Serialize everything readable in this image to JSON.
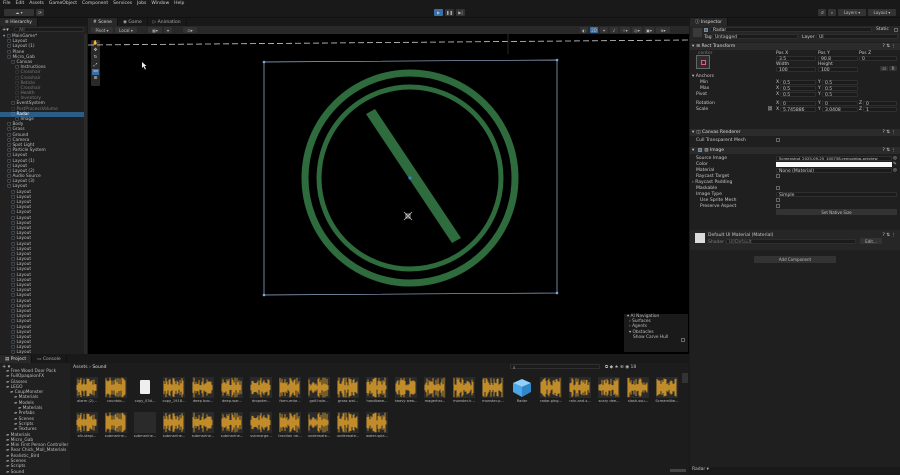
{
  "menu": [
    "File",
    "Edit",
    "Assets",
    "GameObject",
    "Component",
    "Services",
    "Jobs",
    "Window",
    "Help"
  ],
  "toolbar": {
    "account_label": "",
    "layers_label": "Layers",
    "layout_label": "Layout"
  },
  "hierarchy": {
    "tab_label": "Hierarchy",
    "search_placeholder": "All",
    "rows": [
      {
        "label": "MainGame*",
        "indent": 0,
        "style": "normal"
      },
      {
        "label": "Layout",
        "indent": 1,
        "style": "normal"
      },
      {
        "label": "Layout (1)",
        "indent": 1,
        "style": "normal"
      },
      {
        "label": "Plane",
        "indent": 1,
        "style": "normal"
      },
      {
        "label": "Micro_Gab",
        "indent": 1,
        "style": "normal"
      },
      {
        "label": "Canvas",
        "indent": 2,
        "style": "normal"
      },
      {
        "label": "Instructions",
        "indent": 3,
        "style": "normal"
      },
      {
        "label": "Crosshair",
        "indent": 3,
        "style": "dim"
      },
      {
        "label": "Crosshair",
        "indent": 3,
        "style": "dim"
      },
      {
        "label": "Reticle",
        "indent": 3,
        "style": "dim"
      },
      {
        "label": "Crosshair",
        "indent": 3,
        "style": "dim"
      },
      {
        "label": "Health",
        "indent": 3,
        "style": "dim"
      },
      {
        "label": "Inventory",
        "indent": 3,
        "style": "dim"
      },
      {
        "label": "EventSystem",
        "indent": 2,
        "style": "normal"
      },
      {
        "label": "PostProcessVolume",
        "indent": 2,
        "style": "dim"
      },
      {
        "label": "Radar",
        "indent": 2,
        "style": "selected"
      },
      {
        "label": "Image",
        "indent": 3,
        "style": "normal"
      },
      {
        "label": "Body",
        "indent": 1,
        "style": "normal"
      },
      {
        "label": "Grass",
        "indent": 1,
        "style": "normal"
      },
      {
        "label": "Ground",
        "indent": 1,
        "style": "normal"
      },
      {
        "label": "Camera",
        "indent": 1,
        "style": "normal"
      },
      {
        "label": "Spot Light",
        "indent": 1,
        "style": "normal"
      },
      {
        "label": "Particle System",
        "indent": 1,
        "style": "normal"
      },
      {
        "label": "Layout",
        "indent": 1,
        "style": "normal"
      },
      {
        "label": "Layout (1)",
        "indent": 1,
        "style": "normal"
      },
      {
        "label": "Layout",
        "indent": 1,
        "style": "normal"
      },
      {
        "label": "Layout (2)",
        "indent": 1,
        "style": "normal"
      },
      {
        "label": "Audio Source",
        "indent": 1,
        "style": "normal"
      },
      {
        "label": "Layout (3)",
        "indent": 1,
        "style": "normal"
      },
      {
        "label": "Layout",
        "indent": 1,
        "style": "normal"
      },
      {
        "label": "Layout",
        "indent": 2,
        "style": "normal"
      },
      {
        "label": "Layout",
        "indent": 2,
        "style": "normal"
      },
      {
        "label": "Layout",
        "indent": 2,
        "style": "normal"
      },
      {
        "label": "Layout",
        "indent": 2,
        "style": "normal"
      },
      {
        "label": "Layout",
        "indent": 2,
        "style": "normal"
      },
      {
        "label": "Layout",
        "indent": 2,
        "style": "normal"
      },
      {
        "label": "Layout",
        "indent": 2,
        "style": "normal"
      },
      {
        "label": "Layout",
        "indent": 2,
        "style": "normal"
      },
      {
        "label": "Layout",
        "indent": 2,
        "style": "normal"
      },
      {
        "label": "Layout",
        "indent": 2,
        "style": "normal"
      },
      {
        "label": "Layout",
        "indent": 2,
        "style": "normal"
      },
      {
        "label": "Layout",
        "indent": 2,
        "style": "normal"
      },
      {
        "label": "Layout",
        "indent": 2,
        "style": "normal"
      },
      {
        "label": "Layout",
        "indent": 2,
        "style": "normal"
      },
      {
        "label": "Layout",
        "indent": 2,
        "style": "normal"
      },
      {
        "label": "Layout",
        "indent": 2,
        "style": "normal"
      },
      {
        "label": "Layout",
        "indent": 2,
        "style": "normal"
      },
      {
        "label": "Layout",
        "indent": 2,
        "style": "normal"
      },
      {
        "label": "Layout",
        "indent": 2,
        "style": "normal"
      },
      {
        "label": "Layout",
        "indent": 2,
        "style": "normal"
      },
      {
        "label": "Layout",
        "indent": 2,
        "style": "normal"
      },
      {
        "label": "Layout",
        "indent": 2,
        "style": "normal"
      },
      {
        "label": "Layout",
        "indent": 2,
        "style": "normal"
      },
      {
        "label": "Layout",
        "indent": 2,
        "style": "normal"
      },
      {
        "label": "Layout",
        "indent": 2,
        "style": "normal"
      },
      {
        "label": "Layout",
        "indent": 2,
        "style": "normal"
      },
      {
        "label": "Layout",
        "indent": 2,
        "style": "normal"
      },
      {
        "label": "Layout",
        "indent": 2,
        "style": "normal"
      },
      {
        "label": "Layout",
        "indent": 2,
        "style": "normal"
      },
      {
        "label": "Layout",
        "indent": 2,
        "style": "normal"
      },
      {
        "label": "Layout",
        "indent": 2,
        "style": "normal"
      },
      {
        "label": "Layout",
        "indent": 2,
        "style": "normal"
      },
      {
        "label": "Layout",
        "indent": 2,
        "style": "normal"
      }
    ]
  },
  "scene": {
    "tabs": [
      "Scene",
      "Game",
      "Animation"
    ],
    "pivot_label": "Pivot",
    "local_label": "Local",
    "overlay": {
      "title": "AI Navigation",
      "items": [
        "Surfaces",
        "Agents",
        "Obstacles",
        "Show Carve Hull"
      ]
    },
    "radar_color": "#2e6b3d"
  },
  "inspector": {
    "tab_label": "Inspector",
    "object_name": "Radar",
    "static_label": "Static",
    "tag_label": "Tag",
    "tag_value": "Untagged",
    "layer_label": "Layer",
    "layer_value": "UI",
    "rect_transform": {
      "title": "Rect Transform",
      "anchor_preset": "center",
      "pos_x_label": "Pos X",
      "pos_y_label": "Pos Y",
      "pos_z_label": "Pos Z",
      "pos_x": "3.5",
      "pos_y": "90.8",
      "pos_z": "0",
      "width_label": "Width",
      "height_label": "Height",
      "width": "100",
      "height": "100",
      "anchors_label": "Anchors",
      "min_label": "Min",
      "min_x": "0.5",
      "min_y": "0.5",
      "max_label": "Max",
      "max_x": "0.5",
      "max_y": "0.5",
      "pivot_label": "Pivot",
      "pivot_x": "0.5",
      "pivot_y": "0.5",
      "rotation_label": "Rotation",
      "rot_x": "0",
      "rot_y": "0",
      "rot_z": "0",
      "scale_label": "Scale",
      "scale_x": "5.745886",
      "scale_y": "3.0408",
      "scale_z": "1"
    },
    "canvas_renderer": {
      "title": "Canvas Renderer",
      "cull_label": "Cull Transparent Mesh"
    },
    "image": {
      "title": "Image",
      "source_label": "Source Image",
      "source_value": "Screenshot_2025-09-25_100738-removebg-preview",
      "color_label": "Color",
      "material_label": "Material",
      "material_value": "None (Material)",
      "raycast_label": "Raycast Target",
      "padding_label": "Raycast Padding",
      "maskable_label": "Maskable",
      "type_label": "Image Type",
      "type_value": "Simple",
      "sprite_mesh_label": "Use Sprite Mesh",
      "preserve_label": "Preserve Aspect",
      "native_size_label": "Set Native Size"
    },
    "material": {
      "title": "Default UI Material (Material)",
      "shader_label": "Shader",
      "shader_value": "UI/Default",
      "edit_label": "Edit..."
    },
    "add_component_label": "Add Component",
    "footer_label": "Radar"
  },
  "project": {
    "tabs": [
      "Project",
      "Console"
    ],
    "breadcrumb": [
      "Assets",
      "Sound"
    ],
    "tree": [
      {
        "label": "Free Wood Door Pack",
        "indent": 1
      },
      {
        "label": "FullOpaqaionFX",
        "indent": 1
      },
      {
        "label": "Glasses",
        "indent": 1
      },
      {
        "label": "LEGO",
        "indent": 1
      },
      {
        "label": "CoupMonster",
        "indent": 2
      },
      {
        "label": "Materials",
        "indent": 3
      },
      {
        "label": "Models",
        "indent": 3
      },
      {
        "label": "Materials",
        "indent": 4
      },
      {
        "label": "Prefabs",
        "indent": 3
      },
      {
        "label": "Scenes",
        "indent": 3
      },
      {
        "label": "Scripts",
        "indent": 3
      },
      {
        "label": "Textures",
        "indent": 3
      },
      {
        "label": "Materials",
        "indent": 1
      },
      {
        "label": "Micro_Gab",
        "indent": 1
      },
      {
        "label": "Mini First Person Controller",
        "indent": 1
      },
      {
        "label": "Rear Chick_Mall_Materials",
        "indent": 1
      },
      {
        "label": "Realistic_Bird",
        "indent": 1
      },
      {
        "label": "Scenes",
        "indent": 1
      },
      {
        "label": "Scripts",
        "indent": 1
      },
      {
        "label": "Sound",
        "indent": 1
      }
    ],
    "assets_row1": [
      {
        "label": "alarm (2)...",
        "kind": "wave"
      },
      {
        "label": "countdo...",
        "kind": "wave"
      },
      {
        "label": "copy_03d...",
        "kind": "doc"
      },
      {
        "label": "copy_1918...",
        "kind": "wave"
      },
      {
        "label": "deep boo...",
        "kind": "wave"
      },
      {
        "label": "deep-war...",
        "kind": "wave"
      },
      {
        "label": "dropster...",
        "kind": "wave"
      },
      {
        "label": "farm-ente...",
        "kind": "wave"
      },
      {
        "label": "golf-hole...",
        "kind": "wave"
      },
      {
        "label": "grass wal...",
        "kind": "wave"
      },
      {
        "label": "handbase...",
        "kind": "wave"
      },
      {
        "label": "heavy wea...",
        "kind": "wave"
      },
      {
        "label": "magerhar...",
        "kind": "wave"
      },
      {
        "label": "monster-h...",
        "kind": "wave"
      },
      {
        "label": "monster-p...",
        "kind": "wave"
      },
      {
        "label": "Radar",
        "kind": "cube"
      },
      {
        "label": "radar-ping...",
        "kind": "wave"
      },
      {
        "label": "rain-and-s...",
        "kind": "wave"
      },
      {
        "label": "scary dee...",
        "kind": "wave"
      },
      {
        "label": "slash-sou...",
        "kind": "wave"
      },
      {
        "label": "Screamlike...",
        "kind": "wave"
      }
    ],
    "assets_row2": [
      {
        "label": "sfx-stepl...",
        "kind": "wave"
      },
      {
        "label": "submarine...",
        "kind": "wave"
      },
      {
        "label": "submarine...",
        "kind": "blank"
      },
      {
        "label": "submarine...",
        "kind": "wave"
      },
      {
        "label": "submarine...",
        "kind": "wave"
      },
      {
        "label": "submarine...",
        "kind": "wave"
      },
      {
        "label": "submarge...",
        "kind": "wave"
      },
      {
        "label": "traction rai...",
        "kind": "wave"
      },
      {
        "label": "underwate...",
        "kind": "wave"
      },
      {
        "label": "underwate...",
        "kind": "wave"
      },
      {
        "label": "water-spla...",
        "kind": "wave"
      }
    ],
    "wave_color": "#e8a62a"
  }
}
